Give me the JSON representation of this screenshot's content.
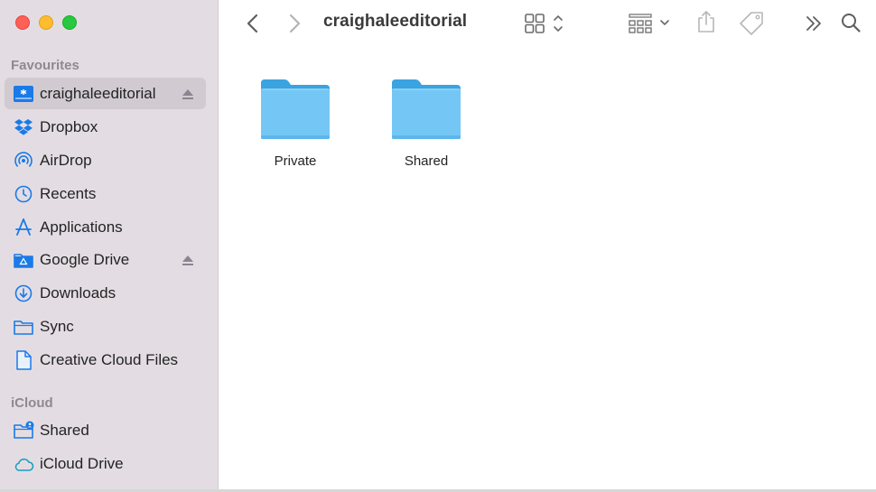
{
  "window": {
    "title": "craighaleeditorial"
  },
  "sidebar": {
    "sections": [
      {
        "title": "Favourites",
        "items": [
          {
            "label": "craighaleeditorial",
            "icon": "network-drive-icon",
            "selected": true,
            "eject": true
          },
          {
            "label": "Dropbox",
            "icon": "dropbox-icon",
            "selected": false,
            "eject": false
          },
          {
            "label": "AirDrop",
            "icon": "airdrop-icon",
            "selected": false,
            "eject": false
          },
          {
            "label": "Recents",
            "icon": "clock-icon",
            "selected": false,
            "eject": false
          },
          {
            "label": "Applications",
            "icon": "applications-icon",
            "selected": false,
            "eject": false
          },
          {
            "label": "Google Drive",
            "icon": "google-drive-folder-icon",
            "selected": false,
            "eject": true
          },
          {
            "label": "Downloads",
            "icon": "download-icon",
            "selected": false,
            "eject": false
          },
          {
            "label": "Sync",
            "icon": "folder-icon",
            "selected": false,
            "eject": false
          },
          {
            "label": "Creative Cloud Files",
            "icon": "document-icon",
            "selected": false,
            "eject": false
          }
        ]
      },
      {
        "title": "iCloud",
        "items": [
          {
            "label": "Shared",
            "icon": "shared-folder-icon",
            "selected": false,
            "eject": false
          },
          {
            "label": "iCloud Drive",
            "icon": "cloud-icon",
            "selected": false,
            "eject": false
          }
        ]
      }
    ]
  },
  "toolbar": {
    "back_icon": "chevron-left-icon",
    "forward_icon": "chevron-right-icon",
    "view_icon": "icon-grid-view-icon",
    "group_icon": "group-by-icon",
    "share_icon": "share-icon",
    "tag_icon": "tag-icon",
    "more_icon": "chevron-double-right-icon",
    "search_icon": "search-icon"
  },
  "content": {
    "items": [
      {
        "label": "Private",
        "icon": "folder-icon"
      },
      {
        "label": "Shared",
        "icon": "folder-icon"
      }
    ]
  },
  "colors": {
    "sidebar_bg": "#e3dde3",
    "accent": "#1a7ae8",
    "folder_light": "#74c7f5",
    "folder_dark": "#3aa3e0"
  }
}
